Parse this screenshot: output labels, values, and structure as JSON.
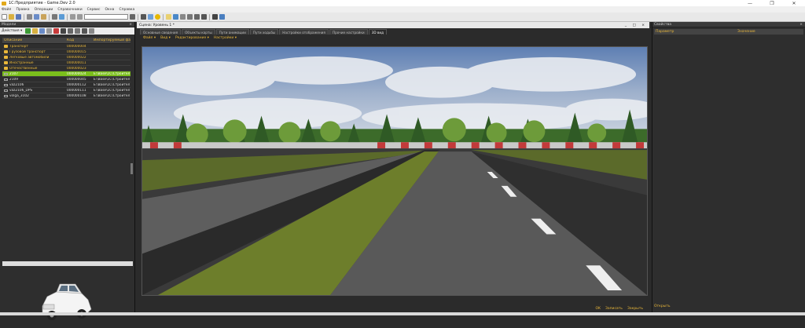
{
  "window": {
    "title": "1С:Предприятие - Game.Dev 2.0",
    "controls": [
      "—",
      "❐",
      "✕"
    ]
  },
  "menubar": [
    "Файл",
    "Правка",
    "Операции",
    "Справочники",
    "Сервис",
    "Окна",
    "Справка"
  ],
  "left_panel": {
    "title": "Модели",
    "actions_label": "Действия ▾",
    "columns": [
      "Описание",
      "Код",
      "Импортируемый фай"
    ],
    "rows": [
      {
        "name": "Транспорт",
        "code": "000000004",
        "file": "",
        "kind": "folder"
      },
      {
        "name": "Грузовой транспорт",
        "code": "000000015",
        "file": "",
        "kind": "folder"
      },
      {
        "name": "Легковые автомобили",
        "code": "000000022",
        "file": "",
        "kind": "folder"
      },
      {
        "name": "Иностранные",
        "code": "000000011",
        "file": "",
        "kind": "folder"
      },
      {
        "name": "Отечественные",
        "code": "000000023",
        "file": "",
        "kind": "folder"
      },
      {
        "name": "2107",
        "code": "000000024",
        "file": "E:\\Base\\1С\\Строител",
        "kind": "item",
        "selected": true
      },
      {
        "name": "2109",
        "code": "000000045",
        "file": "E:\\Base\\1С\\Строител",
        "kind": "item"
      },
      {
        "name": "vaz2106",
        "code": "000000112",
        "file": "E:\\Base\\1С\\Строител",
        "kind": "item"
      },
      {
        "name": "vaz2106_DPS",
        "code": "000000111",
        "file": "E:\\Base\\1С\\Строител",
        "kind": "item"
      },
      {
        "name": "volga_3102",
        "code": "000000108",
        "file": "E:\\Base\\1С\\Строител",
        "kind": "item"
      }
    ]
  },
  "center": {
    "doc_title": "Сцена: Уровень 1 *",
    "doc_buttons": "_ □ ×",
    "tabs": [
      "Основные сведения",
      "Объекты карты",
      "Пути анимации",
      "Пути ходьбы",
      "Настройки отображения",
      "Прочие настройки",
      "3D вид"
    ],
    "active_tab": 6,
    "view_menu": [
      "Файл ▾",
      "Вид ▾",
      "Редактирование ▾",
      "Настройки ▾"
    ],
    "footer": [
      "OK",
      "Записать",
      "Закрыть"
    ]
  },
  "right_panel": {
    "title": "Свойства",
    "columns": [
      "Параметр",
      "Значение"
    ],
    "footer": "Открыть"
  },
  "colors": {
    "accent": "#e9b73a",
    "selection": "#7bbf1c",
    "panel_bg": "#2e2e2e"
  }
}
